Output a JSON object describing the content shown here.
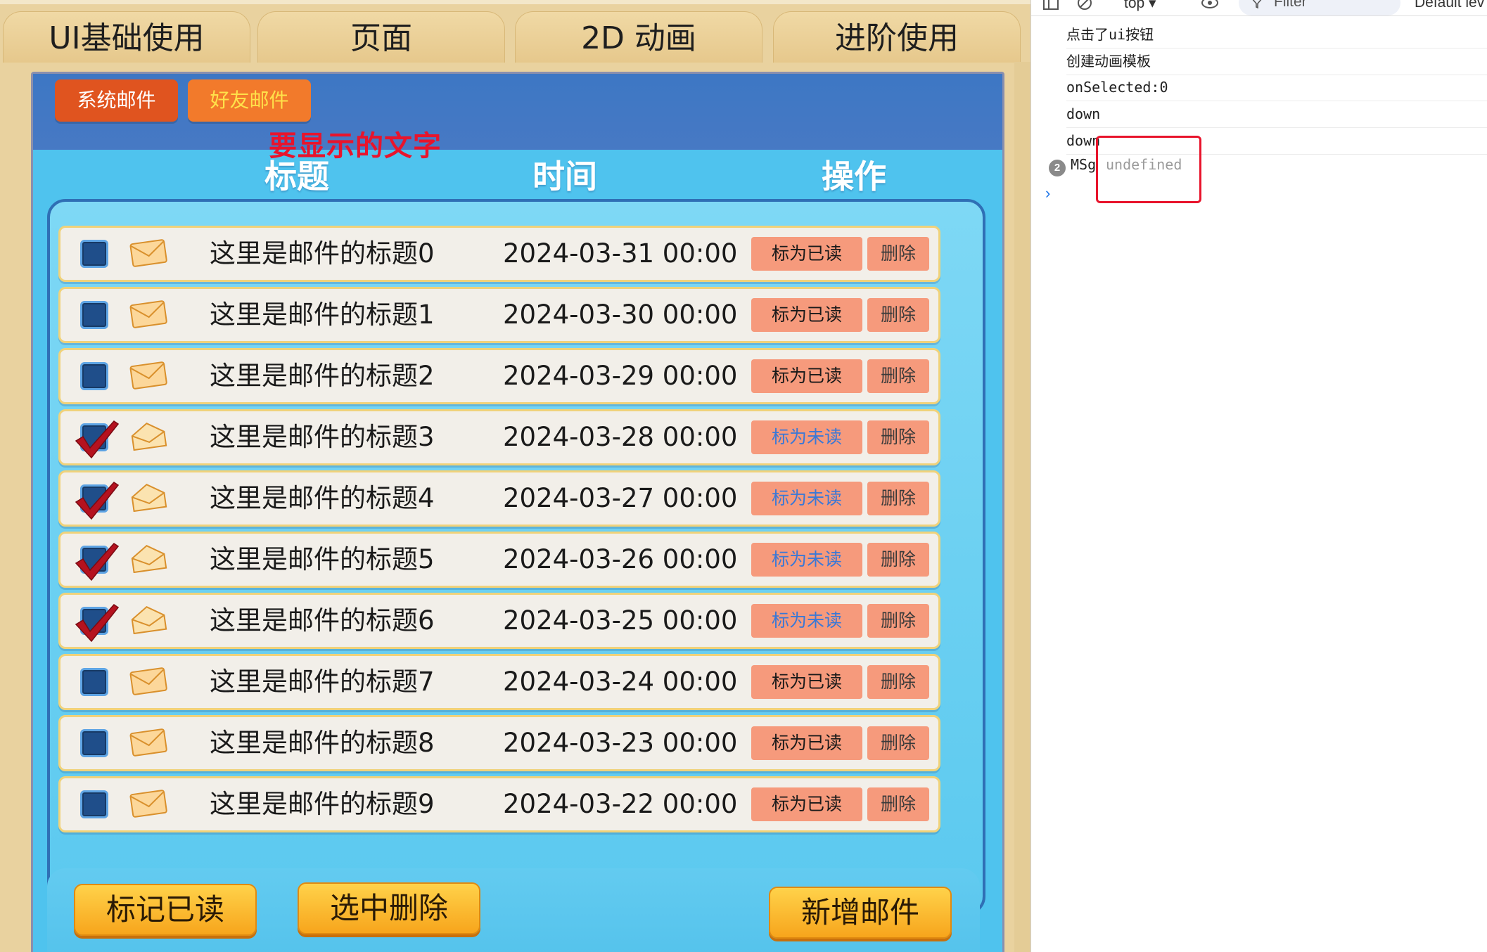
{
  "tabs": [
    {
      "label": "UI基础使用"
    },
    {
      "label": "页面"
    },
    {
      "label": "2D 动画"
    },
    {
      "label": "进阶使用"
    }
  ],
  "mail_tabs": {
    "system": "系统邮件",
    "friend": "好友邮件"
  },
  "overlay_text": "要显示的文字",
  "columns": {
    "title": "标题",
    "time": "时间",
    "action": "操作"
  },
  "mails": [
    {
      "title": "这里是邮件的标题0",
      "time": "2024-03-31 00:00",
      "read_label": "标为已读",
      "checked": false,
      "opened": false,
      "delete_label": "删除"
    },
    {
      "title": "这里是邮件的标题1",
      "time": "2024-03-30 00:00",
      "read_label": "标为已读",
      "checked": false,
      "opened": false,
      "delete_label": "删除"
    },
    {
      "title": "这里是邮件的标题2",
      "time": "2024-03-29 00:00",
      "read_label": "标为已读",
      "checked": false,
      "opened": false,
      "delete_label": "删除"
    },
    {
      "title": "这里是邮件的标题3",
      "time": "2024-03-28 00:00",
      "read_label": "标为未读",
      "checked": true,
      "opened": true,
      "delete_label": "删除"
    },
    {
      "title": "这里是邮件的标题4",
      "time": "2024-03-27 00:00",
      "read_label": "标为未读",
      "checked": true,
      "opened": true,
      "delete_label": "删除"
    },
    {
      "title": "这里是邮件的标题5",
      "time": "2024-03-26 00:00",
      "read_label": "标为未读",
      "checked": true,
      "opened": true,
      "delete_label": "删除"
    },
    {
      "title": "这里是邮件的标题6",
      "time": "2024-03-25 00:00",
      "read_label": "标为未读",
      "checked": true,
      "opened": true,
      "delete_label": "删除"
    },
    {
      "title": "这里是邮件的标题7",
      "time": "2024-03-24 00:00",
      "read_label": "标为已读",
      "checked": false,
      "opened": false,
      "delete_label": "删除"
    },
    {
      "title": "这里是邮件的标题8",
      "time": "2024-03-23 00:00",
      "read_label": "标为已读",
      "checked": false,
      "opened": false,
      "delete_label": "删除"
    },
    {
      "title": "这里是邮件的标题9",
      "time": "2024-03-22 00:00",
      "read_label": "标为已读",
      "checked": false,
      "opened": false,
      "delete_label": "删除"
    }
  ],
  "bottom_buttons": {
    "mark_read": "标记已读",
    "delete_selected": "选中删除",
    "new_mail": "新增邮件"
  },
  "devtools": {
    "context": "top ▾",
    "filter_placeholder": "Filter",
    "levels": "Default lev",
    "logs": [
      "点击了ui按钮",
      "创建动画模板",
      "onSelected:0",
      "down",
      "down"
    ],
    "repeat_count": "2",
    "repeat_msg": "MSg",
    "repeat_value": "undefined",
    "prompt": "›"
  },
  "colors": {
    "game_bg": "#e9d29f",
    "panel_blue": "#4fc3ee",
    "header_blue": "#3d77c4",
    "highlight_red": "#e8142c",
    "unread_label_blue": "#3a78d6"
  }
}
